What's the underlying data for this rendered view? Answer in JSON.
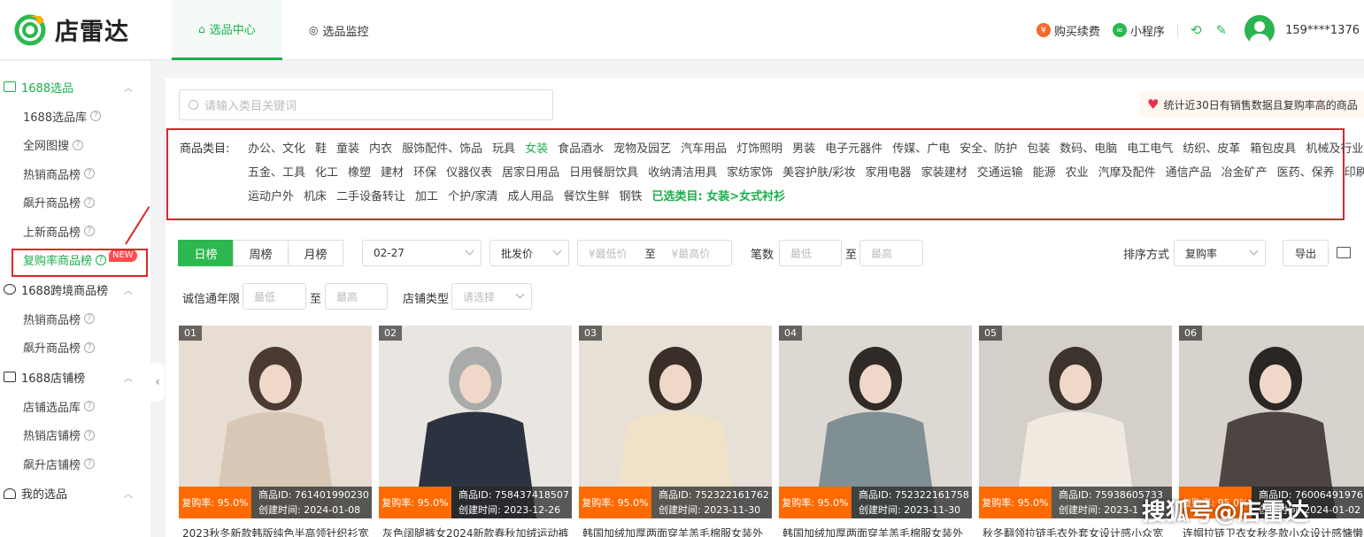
{
  "brand": {
    "name": "店雷达",
    "color": "#1aaf4a"
  },
  "topnav": [
    {
      "label": "选品中心",
      "icon": "bag-icon"
    },
    {
      "label": "选品监控",
      "icon": "eye-icon"
    }
  ],
  "top_right": {
    "buy_label": "购买续费",
    "mini_program_label": "小程序",
    "phone": "159****1376"
  },
  "sidebar": {
    "groups": [
      {
        "label": "1688选品",
        "items": [
          "1688选品库",
          "全网图搜",
          "热销商品榜",
          "飙升商品榜",
          "上新商品榜",
          "复购率商品榜"
        ]
      },
      {
        "label": "1688跨境商品榜",
        "items": [
          "热销商品榜",
          "飙升商品榜"
        ]
      },
      {
        "label": "1688店铺榜",
        "items": [
          "店铺选品库",
          "热销店铺榜",
          "飙升店铺榜"
        ]
      },
      {
        "label": "我的选品",
        "items": []
      }
    ],
    "new_badge": "NEW"
  },
  "search": {
    "placeholder": "请输入类目关键词"
  },
  "notice": "统计近30日有销售数据且复购率高的商品",
  "categories": {
    "label": "商品类目:",
    "row1": [
      "办公、文化",
      "鞋",
      "童装",
      "内衣",
      "服饰配件、饰品",
      "玩具",
      "女装",
      "食品酒水",
      "宠物及园艺",
      "汽车用品",
      "灯饰照明",
      "男装",
      "电子元器件",
      "传媒、广电",
      "安全、防护",
      "包装",
      "数码、电脑",
      "电工电气",
      "纺织、皮革",
      "箱包皮具",
      "机械及行业设备"
    ],
    "row2": [
      "五金、工具",
      "化工",
      "橡塑",
      "建材",
      "环保",
      "仪器仪表",
      "居家日用品",
      "日用餐厨饮具",
      "收纳清洁用具",
      "家纺家饰",
      "美容护肤/彩妆",
      "家用电器",
      "家装建材",
      "交通运输",
      "能源",
      "农业",
      "汽摩及配件",
      "通信产品",
      "冶金矿产",
      "医药、保养",
      "印刷"
    ],
    "row3": [
      "运动户外",
      "机床",
      "二手设备转让",
      "加工",
      "个护/家清",
      "成人用品",
      "餐饮生鲜",
      "钢铁"
    ],
    "selected": "已选类目: 女装>女式衬衫"
  },
  "toolbar": {
    "tabs": [
      "日榜",
      "周榜",
      "月榜"
    ],
    "date": "02-27",
    "price_type": "批发价",
    "price_min": "¥最低价",
    "price_to": "至",
    "price_max": "¥最高价",
    "count_label": "笔数",
    "min": "最低",
    "to": "至",
    "max": "最高",
    "sort_label": "排序方式",
    "sort_value": "复购率",
    "export": "导出",
    "years_label": "诚信通年限",
    "shop_type_label": "店铺类型",
    "shop_type_placeholder": "请选择"
  },
  "products": [
    {
      "idx": "01",
      "rate": "复购率: 95.0%",
      "id": "商品ID: 761401990230",
      "created": "创建时间: 2024-01-08",
      "title": "2023秋冬新款韩版纯色半高领针织衫宽"
    },
    {
      "idx": "02",
      "rate": "复购率: 95.0%",
      "id": "商品ID: 758437418507",
      "created": "创建时间: 2023-12-26",
      "title": "灰色阔腿裤女2024新款春秋加绒运动裤"
    },
    {
      "idx": "03",
      "rate": "复购率: 95.0%",
      "id": "商品ID: 752322161762",
      "created": "创建时间: 2023-11-30",
      "title": "韩国加绒加厚两面穿羊羔毛棉服女装外"
    },
    {
      "idx": "04",
      "rate": "复购率: 95.0%",
      "id": "商品ID: 752322161758",
      "created": "创建时间: 2023-11-30",
      "title": "韩国加绒加厚两面穿羊羔毛棉服女装外"
    },
    {
      "idx": "05",
      "rate": "复购率: 95.0%",
      "id": "商品ID: 75938605733",
      "created": "创建时间: 2023-1",
      "title": "秋冬翻领拉链毛衣外套女设计感小众宽"
    },
    {
      "idx": "06",
      "rate": "复购率: 95.0%",
      "id": "商品ID: 76006491976",
      "created": "创建时间: 2024-01-02",
      "title": "连帽拉链卫衣女秋冬款小众设计感慵懒"
    }
  ],
  "watermark": "搜狐号@店雷达"
}
